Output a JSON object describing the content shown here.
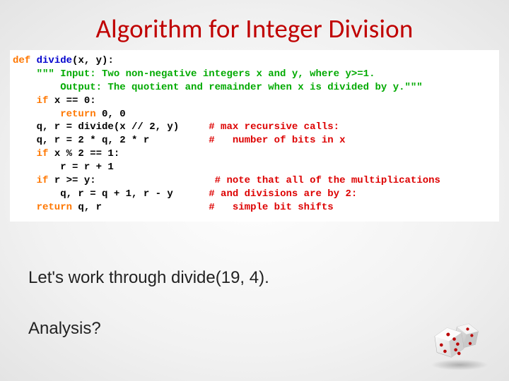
{
  "title": "Algorithm for Integer Division",
  "code": {
    "l1_def": "def",
    "l1_fn": "divide",
    "l1_rest": "(x, y):",
    "l2": "    \"\"\" Input: Two non-negative integers x and y, where y>=1.",
    "l3": "        Output: The quotient and remainder when x is divided by y.\"\"\"",
    "l4_if": "    if",
    "l4_rest": " x == 0:",
    "l5_ret": "        return",
    "l5_rest": " 0, 0",
    "l6_a": "    q, r = divide(x // 2, y)",
    "l6_c": "     # max recursive calls:",
    "l7_a": "    q, r = 2 * q, 2 * r",
    "l7_c": "          #   number of bits in x",
    "l8_if": "    if",
    "l8_rest": " x % 2 == 1:",
    "l9": "        r = r + 1",
    "l10_if": "    if",
    "l10_rest": " r >= y:",
    "l10_c": "                    # note that all of the multiplications",
    "l11_a": "        q, r = q + 1, r - y",
    "l11_c": "      # and divisions are by 2:",
    "l12_ret": "    return",
    "l12_rest": " q, r",
    "l12_c": "                  #   simple bit shifts"
  },
  "body": {
    "line1": "Let's work through divide(19, 4).",
    "line2": "Analysis?"
  },
  "icons": {
    "dice": "dice-pair"
  }
}
